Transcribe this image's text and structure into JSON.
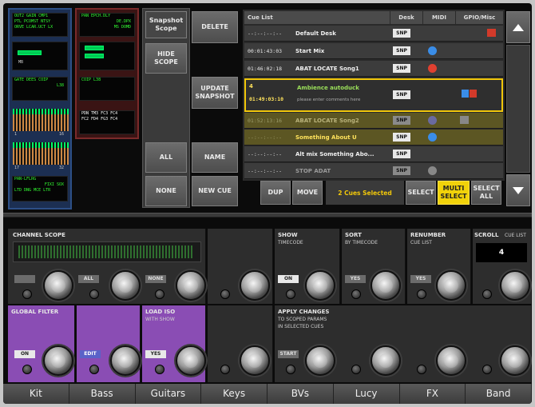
{
  "scope_panels": {
    "col1": {
      "panel1": [
        "OUT2 GAIN CMP1",
        "PTL PCOMST NTSY",
        "ORVE LCAR.UCT LX"
      ],
      "panel2_bar": "MB",
      "panel3": [
        "GATE DEES COIP",
        "L38"
      ],
      "meter1_scale_left": "1",
      "meter1_scale_right": "16",
      "meter2_scale_left": "17",
      "meter2_scale_right": "32",
      "panel5": [
        "PAN-LFLRG",
        "FIXI SOX",
        "LTD DNG MCE LTR"
      ]
    },
    "col2": {
      "panel1": [
        "PAN EPCH.DLY",
        "DE.DPX",
        "MS DOMD"
      ],
      "panel2_bar": "M3",
      "panel3": [
        "COIP L38"
      ],
      "panel4": [
        "PDN TM3 FC3 FC4",
        "FC2 FD4 FG3 FC4"
      ]
    }
  },
  "snapshot_scope": {
    "title": "Snapshot Scope",
    "hide_label": "HIDE SCOPE",
    "all_label": "ALL",
    "none_label": "NONE"
  },
  "actions": {
    "delete": "DELETE",
    "update": "UPDATE SNAPSHOT",
    "name": "NAME",
    "new_cue": "NEW CUE"
  },
  "cue_list": {
    "headers": {
      "cue": "Cue List",
      "desk": "Desk",
      "midi": "MIDI",
      "gpio": "GPIO/Misc"
    },
    "rows": [
      {
        "timecode": "--:--:--:--",
        "name": "Default Desk",
        "desk": "SNP",
        "midi_color": "",
        "gpio": "red"
      },
      {
        "timecode": "00:01:43:03",
        "name": "Start Mix",
        "desk": "SNP",
        "midi_color": "#3a8de8",
        "gpio": ""
      },
      {
        "timecode": "01:46:02:18",
        "name": "ABAT LOCATE Song1",
        "desk": "SNP",
        "midi_color": "#e04030",
        "gpio": ""
      },
      {
        "timecode": "",
        "name": "",
        "desk": "SNP",
        "midi_color": "",
        "gpio": ""
      },
      {
        "timecode": "01:52:13:16",
        "name": "ABAT LOCATE Song2",
        "desk": "SNP",
        "midi_color": "#6a6aa0",
        "gpio": "gray"
      },
      {
        "timecode": "--:--:--:--",
        "name": "Something About U",
        "desk": "SNP",
        "midi_color": "#3a8de8",
        "gpio": ""
      },
      {
        "timecode": "--:--:--:--",
        "name": "Alt mix Something Abo...",
        "desk": "SNP",
        "midi_color": "",
        "gpio": ""
      },
      {
        "timecode": "--:--:--:--",
        "name": "STOP ADAT",
        "desk": "SNP",
        "midi_color": "#888888",
        "gpio": ""
      }
    ],
    "selected": {
      "number": "4",
      "timecode": "01:49:03:10",
      "name": "Ambience autoduck",
      "comment": "please enter comments here",
      "desk": "SNP"
    }
  },
  "cue_toolbar": {
    "dup": "DUP",
    "move": "MOVE",
    "status": "2 Cues Selected",
    "select": "SELECT",
    "multi_select": "MULTI SELECT",
    "select_all": "SELECT ALL"
  },
  "channel_scope": {
    "title": "CHANNEL SCOPE",
    "btn_all": "ALL",
    "btn_none": "NONE"
  },
  "show": {
    "title": "SHOW",
    "sub": "TIMECODE",
    "value": "ON"
  },
  "sort": {
    "title": "SORT",
    "sub": "BY TIMECODE",
    "value": "YES"
  },
  "renumber": {
    "title": "RENUMBER",
    "sub": "CUE LIST",
    "value": "YES"
  },
  "scroll": {
    "title": "SCROLL",
    "sub": "CUE LIST",
    "value": "4"
  },
  "global_filter": {
    "title": "GLOBAL FILTER",
    "value": "ON",
    "edit": "EDIT"
  },
  "load_iso": {
    "title": "LOAD ISO",
    "sub": "WITH SHOW",
    "value": "YES"
  },
  "apply_changes": {
    "title": "APPLY CHANGES",
    "sub1": "TO SCOPED PARAMS",
    "sub2": "IN SELECTED CUES",
    "value": "START"
  },
  "tabs": [
    "Kit",
    "Bass",
    "Guitars",
    "Keys",
    "BVs",
    "Lucy",
    "FX",
    "Band"
  ]
}
